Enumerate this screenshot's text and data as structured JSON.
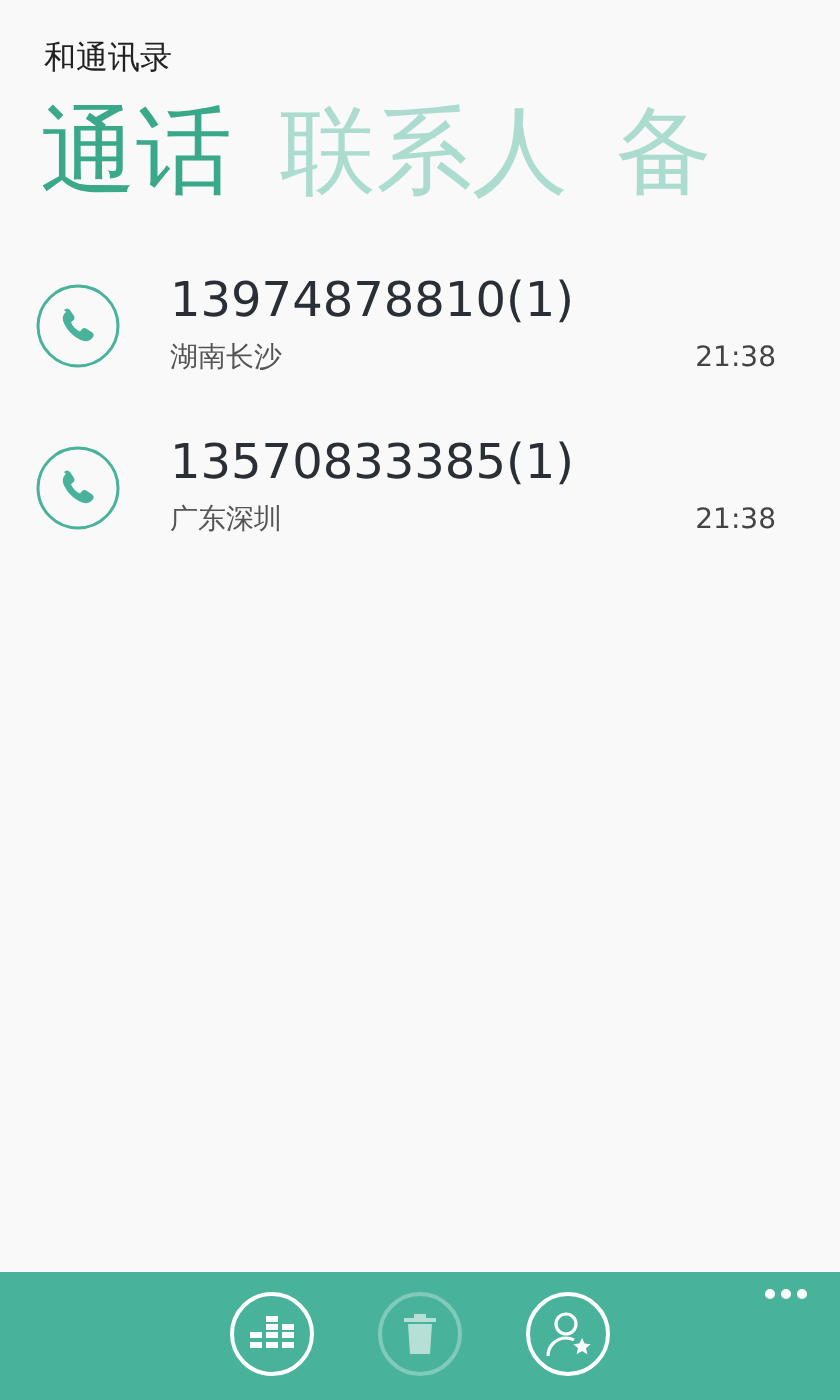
{
  "app_title": "和通讯录",
  "tabs": [
    {
      "label": "通话",
      "selected": true
    },
    {
      "label": "联系人",
      "selected": false
    },
    {
      "label": "备",
      "selected": false
    }
  ],
  "calls": [
    {
      "number": "13974878810(1)",
      "location": "湖南长沙",
      "time": "21:38"
    },
    {
      "number": "13570833385(1)",
      "location": "广东深圳",
      "time": "21:38"
    }
  ],
  "app_bar": {
    "buttons": [
      {
        "kind": "dialpad",
        "disabled": false
      },
      {
        "kind": "delete",
        "disabled": true
      },
      {
        "kind": "favorite-contact",
        "disabled": false
      }
    ]
  }
}
